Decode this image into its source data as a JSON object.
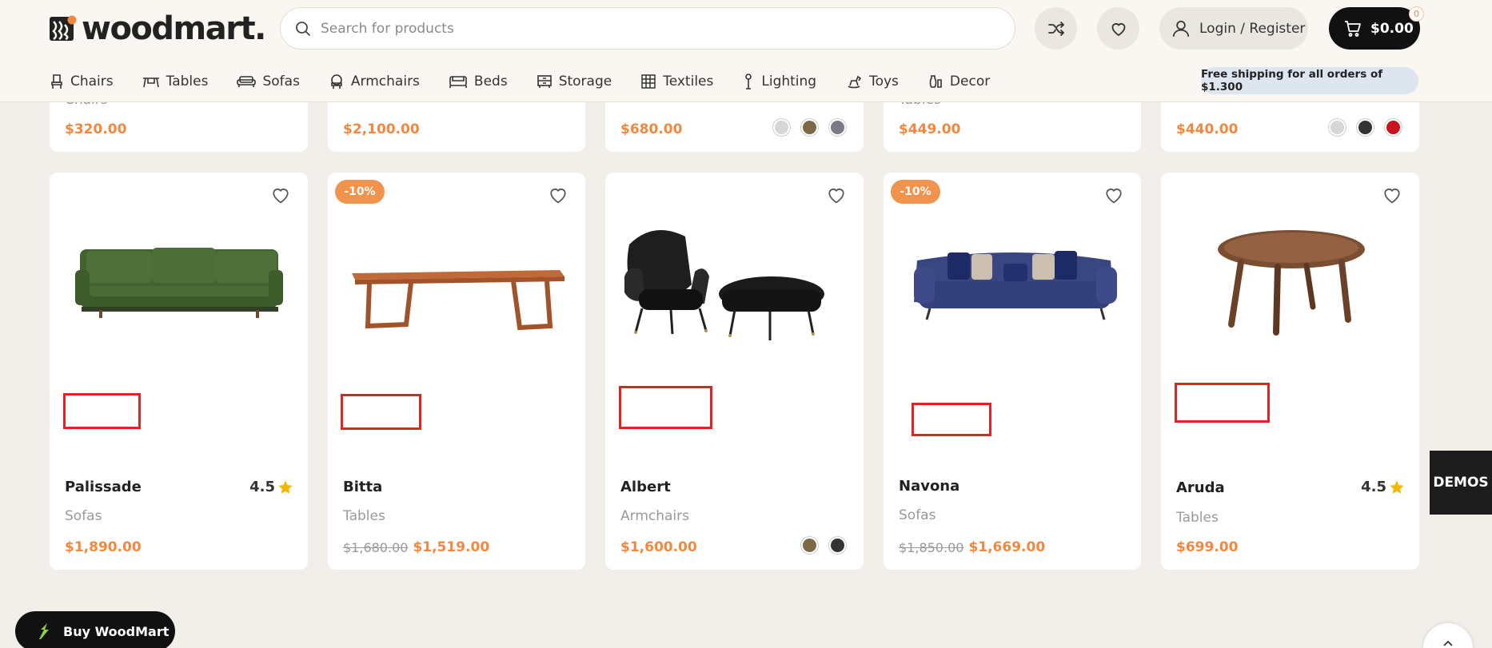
{
  "header": {
    "logo_text": "woodmart.",
    "search": {
      "placeholder": "Search for products"
    },
    "login_label": "Login / Register",
    "cart_total": "$0.00",
    "cart_count": "0",
    "shipping_notice": "Free shipping for all orders of $1.300",
    "nav": [
      {
        "label": "Chairs",
        "icon": "chair-icon"
      },
      {
        "label": "Tables",
        "icon": "table-icon"
      },
      {
        "label": "Sofas",
        "icon": "sofa-icon"
      },
      {
        "label": "Armchairs",
        "icon": "armchair-icon"
      },
      {
        "label": "Beds",
        "icon": "bed-icon"
      },
      {
        "label": "Storage",
        "icon": "storage-icon"
      },
      {
        "label": "Textiles",
        "icon": "textiles-icon"
      },
      {
        "label": "Lighting",
        "icon": "lamp-icon"
      },
      {
        "label": "Toys",
        "icon": "toy-horse-icon"
      },
      {
        "label": "Decor",
        "icon": "vase-icon"
      }
    ]
  },
  "top_row": [
    {
      "category_partial": "Chairs",
      "price": "$320.00",
      "swatches": []
    },
    {
      "category_partial": "",
      "price": "$2,100.00",
      "swatches": []
    },
    {
      "category_partial": "",
      "price": "$680.00",
      "swatches": [
        "#d6d6d6",
        "#7b6a45",
        "#7c7a86"
      ]
    },
    {
      "category_partial": "Tables",
      "price": "$449.00",
      "swatches": []
    },
    {
      "category_partial": "",
      "price": "$440.00",
      "swatches": [
        "#d6d6d6",
        "#333333",
        "#c8141a"
      ]
    }
  ],
  "products": [
    {
      "name": "Palissade",
      "category": "Sofas",
      "price": "$1,890.00",
      "old_price": "",
      "rating": "4.5",
      "badge": "",
      "swatches": []
    },
    {
      "name": "Bitta",
      "category": "Tables",
      "price": "$1,519.00",
      "old_price": "$1,680.00",
      "rating": "",
      "badge": "-10%",
      "swatches": []
    },
    {
      "name": "Albert",
      "category": "Armchairs",
      "price": "$1,600.00",
      "old_price": "",
      "rating": "",
      "badge": "",
      "swatches": [
        "#7b6a45",
        "#333333"
      ]
    },
    {
      "name": "Navona",
      "category": "Sofas",
      "price": "$1,669.00",
      "old_price": "$1,850.00",
      "rating": "",
      "badge": "-10%",
      "swatches": []
    },
    {
      "name": "Aruda",
      "category": "Tables",
      "price": "$699.00",
      "old_price": "",
      "rating": "4.5",
      "badge": "",
      "swatches": []
    }
  ],
  "demos_label": "DEMOS",
  "buy_label": "Buy WoodMart",
  "colors": {
    "accent": "#f2883f",
    "badge": "#f2934d",
    "star": "#f5b800",
    "background": "#f2efea"
  }
}
